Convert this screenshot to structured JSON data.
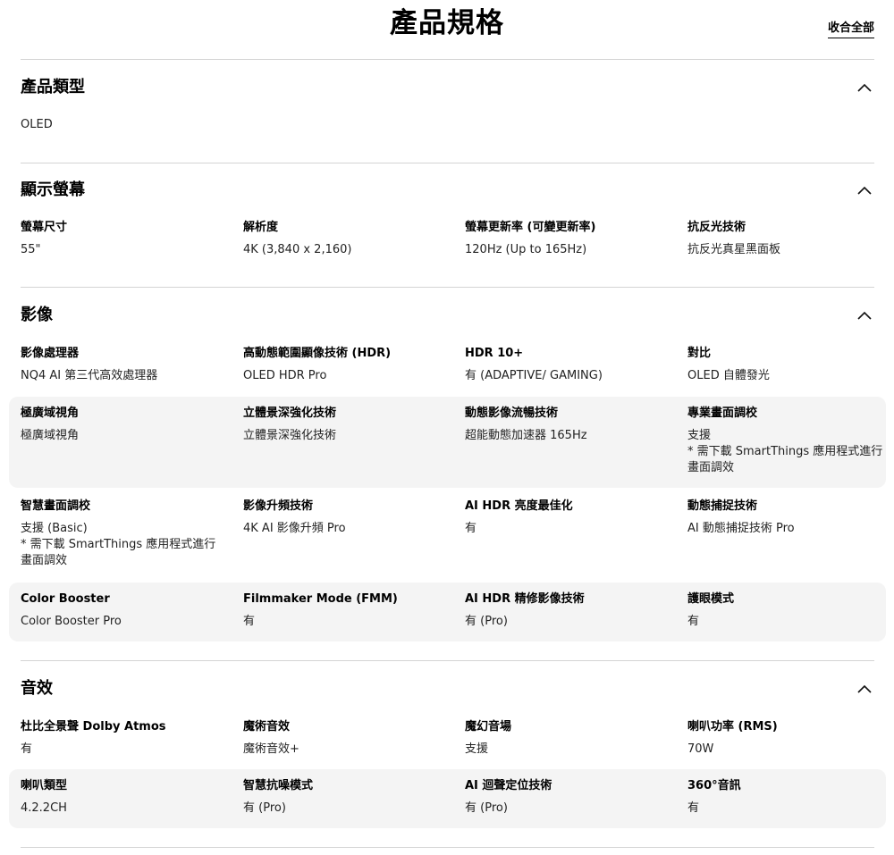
{
  "page": {
    "title": "產品規格",
    "collapse_all": "收合全部"
  },
  "sections": {
    "product_type": {
      "title": "產品類型",
      "value": "OLED"
    },
    "display": {
      "title": "顯示螢幕",
      "rows": [
        [
          {
            "label": "螢幕尺寸",
            "value": "55\""
          },
          {
            "label": "解析度",
            "value": "4K (3,840 x 2,160)"
          },
          {
            "label": "螢幕更新率 (可變更新率)",
            "value": "120Hz (Up to 165Hz)"
          },
          {
            "label": "抗反光技術",
            "value": "抗反光真星黑面板"
          }
        ]
      ]
    },
    "picture": {
      "title": "影像",
      "rows": [
        [
          {
            "label": "影像處理器",
            "value": "NQ4 AI 第三代高效處理器"
          },
          {
            "label": "高動態範圍顯像技術 (HDR)",
            "value": "OLED HDR Pro"
          },
          {
            "label": "HDR 10+",
            "value": "有 (ADAPTIVE/ GAMING)"
          },
          {
            "label": "對比",
            "value": "OLED 自體發光"
          }
        ],
        [
          {
            "label": "極廣域視角",
            "value": "極廣域視角"
          },
          {
            "label": "立體景深強化技術",
            "value": "立體景深強化技術"
          },
          {
            "label": "動態影像流暢技術",
            "value": "超能動態加速器 165Hz"
          },
          {
            "label": "專業畫面調校",
            "value": "支援\n* 需下載 SmartThings 應用程式進行畫面調效"
          }
        ],
        [
          {
            "label": "智慧畫面調校",
            "value": "支援 (Basic)\n* 需下載 SmartThings 應用程式進行畫面調效"
          },
          {
            "label": "影像升頻技術",
            "value": "4K AI 影像升頻 Pro"
          },
          {
            "label": "AI HDR 亮度最佳化",
            "value": "有"
          },
          {
            "label": "動態捕捉技術",
            "value": "AI 動態捕捉技術 Pro"
          }
        ],
        [
          {
            "label": "Color Booster",
            "value": "Color Booster Pro"
          },
          {
            "label": "Filmmaker Mode (FMM)",
            "value": "有"
          },
          {
            "label": "AI HDR 精修影像技術",
            "value": "有 (Pro)"
          },
          {
            "label": "護眼模式",
            "value": "有"
          }
        ]
      ]
    },
    "audio": {
      "title": "音效",
      "rows": [
        [
          {
            "label": "杜比全景聲 Dolby Atmos",
            "value": "有"
          },
          {
            "label": "魔術音效",
            "value": "魔術音效+"
          },
          {
            "label": "魔幻音場",
            "value": "支援"
          },
          {
            "label": "喇叭功率 (RMS)",
            "value": "70W"
          }
        ],
        [
          {
            "label": "喇叭類型",
            "value": "4.2.2CH"
          },
          {
            "label": "智慧抗噪模式",
            "value": "有 (Pro)"
          },
          {
            "label": "AI 迴聲定位技術",
            "value": "有 (Pro)"
          },
          {
            "label": "360°音訊",
            "value": "有"
          }
        ]
      ]
    }
  },
  "icons": {
    "chevron": "chevron-up-icon"
  }
}
